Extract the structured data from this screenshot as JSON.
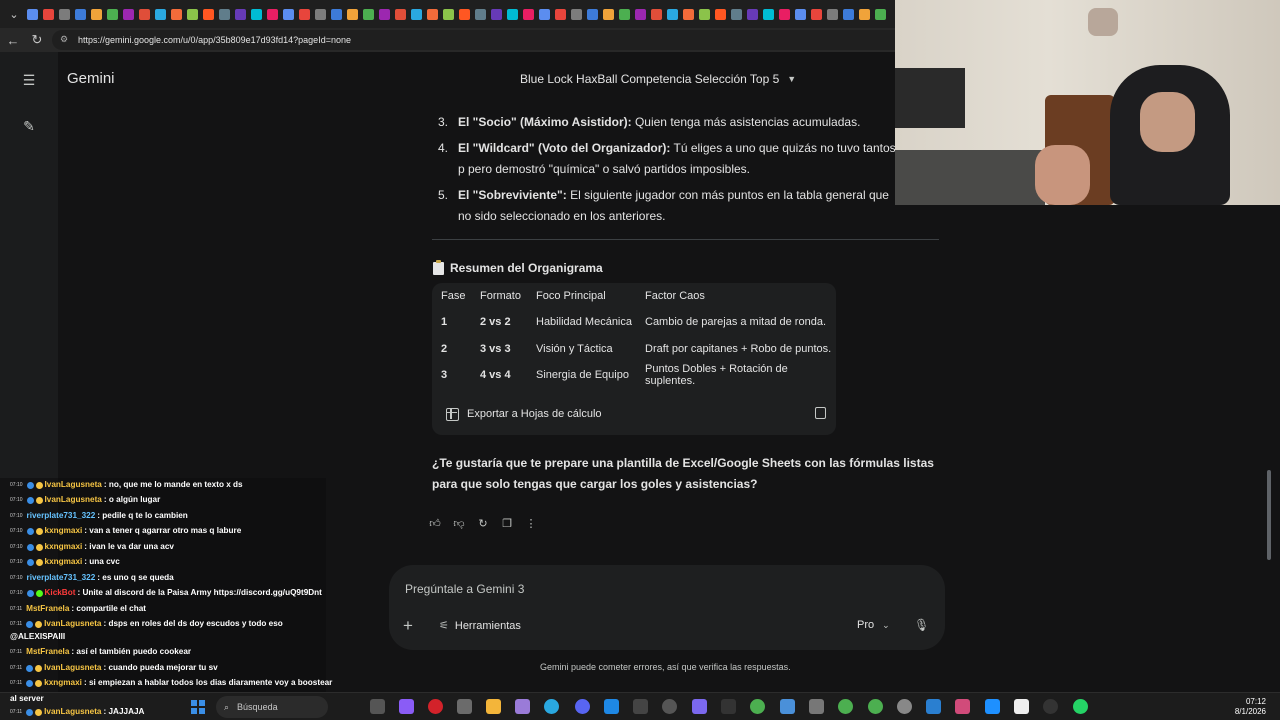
{
  "browser": {
    "url": "https://gemini.google.com/u/0/app/35b809e17d93fd14?pageId=none"
  },
  "app": {
    "brand": "Gemini",
    "chat_title": "Blue Lock HaxBall Competencia Selección Top 5"
  },
  "list_items": [
    {
      "num": "3.",
      "bold": "El \"Socio\" (Máximo Asistidor):",
      "rest": " Quien tenga más asistencias acumuladas."
    },
    {
      "num": "4.",
      "bold": "El \"Wildcard\" (Voto del Organizador):",
      "rest": " Tú eliges a uno que quizás no tuvo tantos p pero demostró \"química\" o salvó partidos imposibles."
    },
    {
      "num": "5.",
      "bold": "El \"Sobreviviente\":",
      "rest": " El siguiente jugador con más puntos en la tabla general que no sido seleccionado en los anteriores."
    }
  ],
  "summary": {
    "title": "Resumen del Organigrama",
    "headers": [
      "Fase",
      "Formato",
      "Foco Principal",
      "Factor Caos"
    ],
    "rows": [
      [
        "1",
        "2 vs 2",
        "Habilidad Mecánica",
        "Cambio de parejas a mitad de ronda."
      ],
      [
        "2",
        "3 vs 3",
        "Visión y Táctica",
        "Draft por capitanes + Robo de puntos."
      ],
      [
        "3",
        "4 vs 4",
        "Sinergia de Equipo",
        "Puntos Dobles + Rotación de suplentes."
      ]
    ],
    "export_label": "Exportar a Hojas de cálculo"
  },
  "question": "¿Te gustaría que te prepare una plantilla de Excel/Google Sheets con las fórmulas listas para que solo tengas que cargar los goles y asistencias?",
  "prompt": {
    "placeholder": "Pregúntale a Gemini 3",
    "tools_label": "Herramientas",
    "model_label": "Pro"
  },
  "disclaimer": "Gemini puede cometer errores, así que verifica las respuestas.",
  "chat_messages": [
    {
      "time": "07:10",
      "user": "IvanLagusneta",
      "color": "#f6c544",
      "text": ": no, que me lo mande en texto x ds"
    },
    {
      "time": "07:10",
      "user": "IvanLagusneta",
      "color": "#f6c544",
      "text": ": o algún lugar"
    },
    {
      "time": "07:10",
      "user": "riverplate731_322",
      "color": "#66c3ff",
      "text": ": pedile q te lo cambien"
    },
    {
      "time": "07:10",
      "user": "kxngmaxi",
      "color": "#f6c544",
      "text": ": van a tener q agarrar otro mas q labure"
    },
    {
      "time": "07:10",
      "user": "kxngmaxi",
      "color": "#f6c544",
      "text": ": ivan le va dar una acv"
    },
    {
      "time": "07:10",
      "user": "kxngmaxi",
      "color": "#f6c544",
      "text": ": una cvc"
    },
    {
      "time": "07:10",
      "user": "riverplate731_322",
      "color": "#66c3ff",
      "text": ": es uno q se queda"
    },
    {
      "time": "07:10",
      "user": "KickBot",
      "color": "#ff3b3b",
      "text": ": Unite al discord de la Paisa Army https://discord.gg/uQ9t9Dnt"
    },
    {
      "time": "07:11",
      "user": "MstFranela",
      "color": "#f6c544",
      "text": ": compartile el chat"
    },
    {
      "time": "07:11",
      "user": "IvanLagusneta",
      "color": "#f6c544",
      "text": ": dsps en roles del ds doy escudos y todo eso"
    },
    {
      "time": "",
      "user": "",
      "color": "#ffffff",
      "text": "@ALEXISPAIII"
    },
    {
      "time": "07:11",
      "user": "MstFranela",
      "color": "#f6c544",
      "text": ": así el también puedo cookear"
    },
    {
      "time": "07:11",
      "user": "IvanLagusneta",
      "color": "#f6c544",
      "text": ": cuando pueda mejorar tu sv"
    },
    {
      "time": "07:11",
      "user": "kxngmaxi",
      "color": "#f6c544",
      "text": ": si empiezan a hablar todos los dias diaramente voy a boostear"
    },
    {
      "time": "",
      "user": "",
      "color": "#ffffff",
      "text": "al server"
    },
    {
      "time": "07:11",
      "user": "IvanLagusneta",
      "color": "#f6c544",
      "text": ": JAJJAJA"
    }
  ],
  "taskbar": {
    "search_label": "Búsqueda",
    "time": "07:12",
    "date": "8/1/2026"
  }
}
